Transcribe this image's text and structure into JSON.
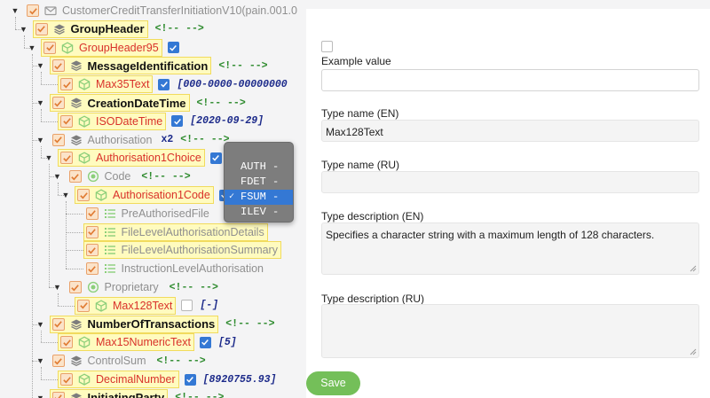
{
  "tree": {
    "rows": [
      {
        "label": "CustomerCreditTransferInitiationV10(pain.001.0",
        "style": "root",
        "icon": "envelope-icon",
        "name": "tree-root-pain001"
      },
      {
        "label": "GroupHeader",
        "style": "bold",
        "icon": "stack-icon",
        "comment": "<!-- -->",
        "name": "tree-node-groupheader"
      },
      {
        "label": "GroupHeader95",
        "style": "red",
        "icon": "cube-icon",
        "name": "tree-node-groupheader95"
      },
      {
        "label": "MessageIdentification",
        "style": "bold",
        "icon": "stack-icon",
        "comment": "<!-- -->",
        "name": "tree-node-messageidentification"
      },
      {
        "label": "Max35Text",
        "style": "red",
        "icon": "cube-icon",
        "value": "[000-0000-00000000",
        "name": "tree-node-max35text"
      },
      {
        "label": "CreationDateTime",
        "style": "bold",
        "icon": "stack-icon",
        "comment": "<!-- -->",
        "name": "tree-node-creationdatetime"
      },
      {
        "label": "ISODateTime",
        "style": "red",
        "icon": "cube-icon",
        "value": "[2020-09-29]",
        "name": "tree-node-isodatetime"
      },
      {
        "label": "Authorisation",
        "style": "grey",
        "icon": "stack-icon",
        "mult": "x2",
        "comment": "<!-- -->",
        "name": "tree-node-authorisation"
      },
      {
        "label": "Authorisation1Choice",
        "style": "red",
        "icon": "cube-icon",
        "name": "tree-node-authorisation1choice"
      },
      {
        "label": "Code",
        "style": "grey",
        "icon": "radio-icon",
        "comment": "<!-- -->",
        "name": "tree-node-code"
      },
      {
        "label": "Authorisation1Code",
        "style": "red",
        "icon": "cube-icon",
        "name": "tree-node-authorisation1code"
      },
      {
        "label": "PreAuthorisedFile",
        "style": "grey",
        "icon": "list-icon",
        "name": "tree-node-preauthorisedfile"
      },
      {
        "label": "FileLevelAuthorisationDetails",
        "style": "grey",
        "icon": "list-icon",
        "name": "tree-node-fileleveldetails"
      },
      {
        "label": "FileLevelAuthorisationSummary",
        "style": "grey",
        "icon": "list-icon",
        "name": "tree-node-filelevelsummary"
      },
      {
        "label": "InstructionLevelAuthorisation",
        "style": "grey",
        "icon": "list-icon",
        "name": "tree-node-instructionlevel"
      },
      {
        "label": "Proprietary",
        "style": "grey",
        "icon": "radio-icon",
        "comment": "<!-- -->",
        "name": "tree-node-proprietary"
      },
      {
        "label": "Max128Text",
        "style": "red",
        "icon": "cube-icon",
        "value": "[-]",
        "name": "tree-node-max128text"
      },
      {
        "label": "NumberOfTransactions",
        "style": "bold",
        "icon": "stack-icon",
        "comment": "<!-- -->",
        "name": "tree-node-numberoftransactions"
      },
      {
        "label": "Max15NumericText",
        "style": "red",
        "icon": "cube-icon",
        "value": "[5]",
        "name": "tree-node-max15numerictext"
      },
      {
        "label": "ControlSum",
        "style": "grey",
        "icon": "stack-icon",
        "comment": "<!-- -->",
        "name": "tree-node-controlsum"
      },
      {
        "label": "DecimalNumber",
        "style": "red",
        "icon": "cube-icon",
        "value": "[8920755.93]",
        "name": "tree-node-decimalnumber"
      },
      {
        "label": "InitiatingParty",
        "style": "bold",
        "icon": "stack-icon",
        "comment": "<!-- -->",
        "name": "tree-node-initiatingparty"
      }
    ]
  },
  "dropdown": {
    "options": [
      {
        "label": "AUTH -",
        "selected": false
      },
      {
        "label": "FDET -",
        "selected": false
      },
      {
        "label": "FSUM -",
        "selected": true
      },
      {
        "label": "ILEV -",
        "selected": false
      }
    ],
    "check_mark": "✓"
  },
  "panel": {
    "example_label": "Example value",
    "example_value": "",
    "type_name_en_label": "Type name (EN)",
    "type_name_en_value": "Max128Text",
    "type_name_ru_label": "Type name (RU)",
    "type_name_ru_value": "",
    "type_desc_en_label": "Type description (EN)",
    "type_desc_en_value": "Specifies a character string with a maximum length of 128 characters.",
    "type_desc_ru_label": "Type description (RU)",
    "type_desc_ru_value": ""
  },
  "footer": {
    "save_label": "Save"
  },
  "colors": {
    "accent": "#3478d4",
    "save": "#74bf59",
    "highlight": "#fffbbf",
    "red_label": "#d9312a",
    "comment": "#2e8b2e",
    "value": "#1c2a8a"
  }
}
